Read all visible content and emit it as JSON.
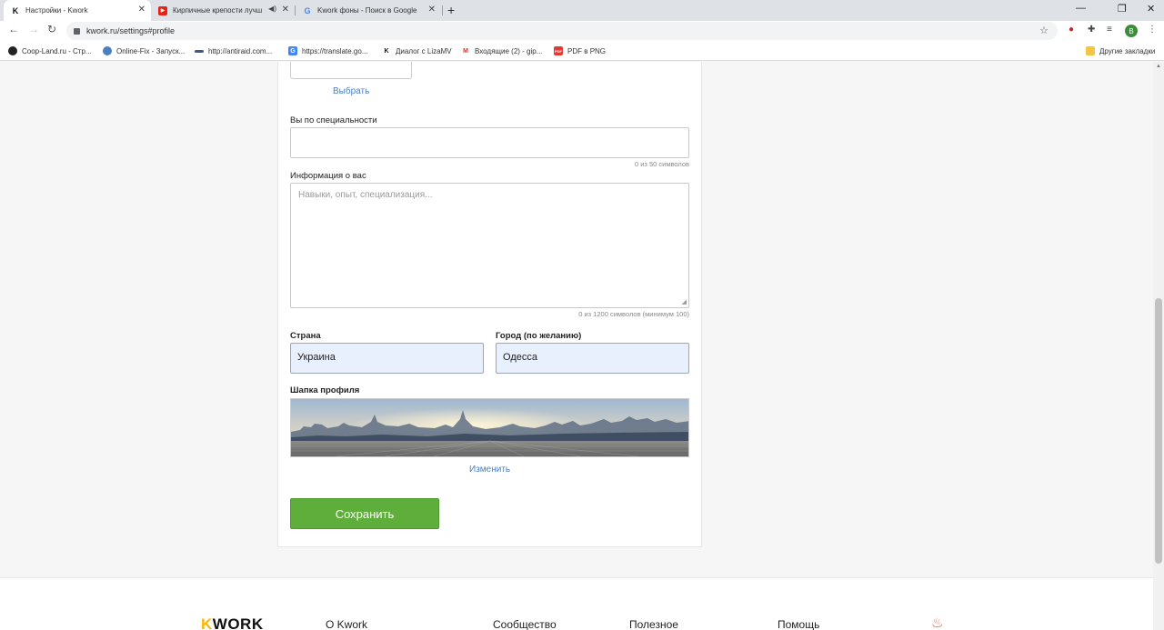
{
  "browser": {
    "tabs": [
      {
        "title": "Настройки - Kwork",
        "favicon": "kwork-icon"
      },
      {
        "title": "Кирпичные крепости лучш",
        "favicon": "youtube-icon"
      },
      {
        "title": "Kwork фоны - Поиск в Google",
        "favicon": "google-icon"
      }
    ],
    "new_tab": "+",
    "url": "kwork.ru/settings#profile",
    "profile_initial": "B",
    "bookmarks": [
      {
        "label": "Coop-Land.ru - Стр...",
        "icon_color": "#222222"
      },
      {
        "label": "Online-Fix - Запуск...",
        "icon_color": "#4a7fc1"
      },
      {
        "label": "http://antiraid.com...",
        "icon_color": "#3d5a80"
      },
      {
        "label": "https://translate.go...",
        "icon_color": "#4285f4"
      },
      {
        "label": "Диалог с LizaMV",
        "icon_color": "#111111"
      },
      {
        "label": "Входящие (2) - gip...",
        "icon_color": "#d93025"
      },
      {
        "label": "PDF в PNG",
        "icon_color": "#e53935"
      }
    ],
    "other_bookmarks": "Другие закладки"
  },
  "form": {
    "choose_link": "Выбрать",
    "specialty_label": "Вы по специальности",
    "specialty_value": "",
    "specialty_hint": "0 из 50 символов",
    "about_label": "Информация о вас",
    "about_placeholder": "Навыки, опыт, специализация...",
    "about_hint": "0 из 1200 символов (минимум 100)",
    "country_label": "Страна",
    "country_value": "Украина",
    "city_label": "Город (по желанию)",
    "city_value": "Одесса",
    "header_label": "Шапка профиля",
    "change_link": "Изменить",
    "save_button": "Сохранить"
  },
  "footer": {
    "logo_k": "K",
    "logo_rest": "WORK",
    "nav": [
      "О Kwork",
      "Сообщество",
      "Полезное",
      "Помощь"
    ]
  },
  "colors": {
    "accent_green": "#5fad3a",
    "link_blue": "#4a7fc1",
    "autofill_blue": "#e8f0fe"
  }
}
